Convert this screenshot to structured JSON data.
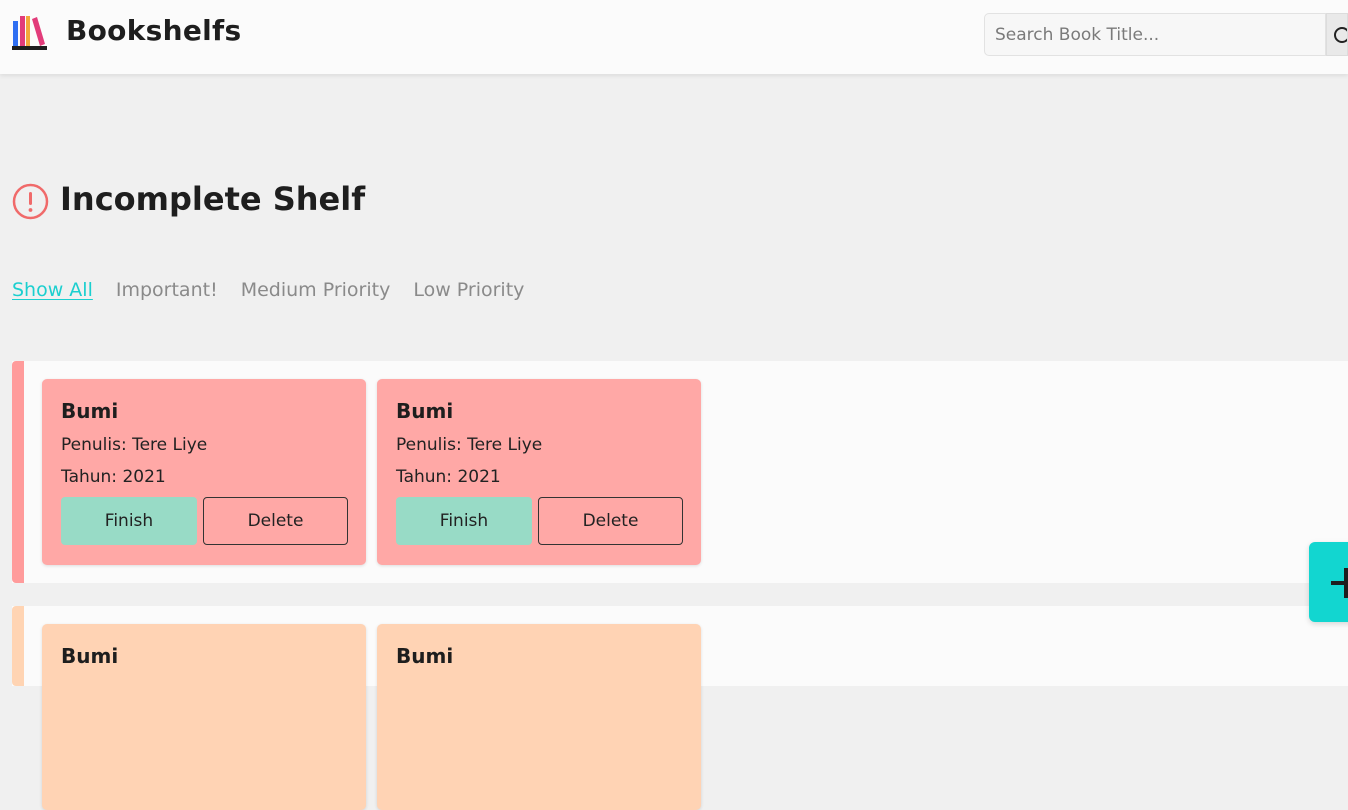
{
  "header": {
    "brand": "Bookshelfs",
    "search_placeholder": "Search Book Title..."
  },
  "section": {
    "title": "Incomplete Shelf"
  },
  "filters": [
    {
      "label": "Show All",
      "active": true
    },
    {
      "label": "Important!",
      "active": false
    },
    {
      "label": "Medium Priority",
      "active": false
    },
    {
      "label": "Low Priority",
      "active": false
    }
  ],
  "shelves": {
    "important": {
      "books": [
        {
          "title": "Bumi",
          "author": "Penulis: Tere Liye",
          "year": "Tahun: 2021",
          "finish_label": "Finish",
          "delete_label": "Delete"
        },
        {
          "title": "Bumi",
          "author": "Penulis: Tere Liye",
          "year": "Tahun: 2021",
          "finish_label": "Finish",
          "delete_label": "Delete"
        }
      ]
    },
    "medium": {
      "books": [
        {
          "title": "Bumi"
        },
        {
          "title": "Bumi"
        }
      ]
    }
  },
  "colors": {
    "accent": "#1bcfcf",
    "important": "#ffa8a6",
    "medium": "#ffd3b4",
    "finish": "#98dbc6",
    "fab": "#12d6d0"
  },
  "icons": {
    "logo": "books-logo-icon",
    "search": "search-icon",
    "alert": "exclamation-circle-icon",
    "fab": "plus-icon"
  }
}
